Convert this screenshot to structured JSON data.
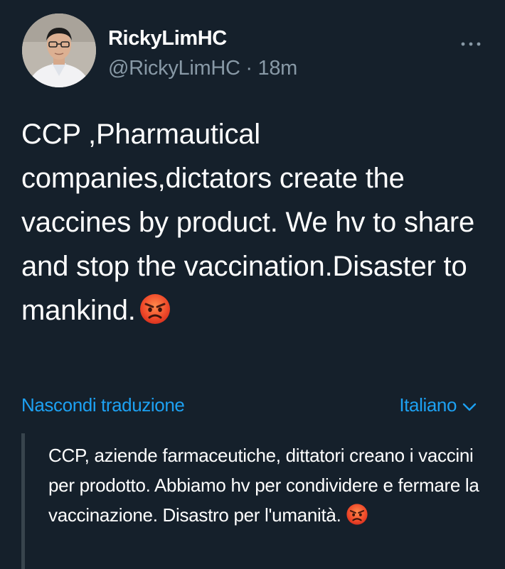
{
  "tweet": {
    "display_name": "RickyLimHC",
    "handle": "@RickyLimHC",
    "separator": " · ",
    "time": "18m",
    "text": "CCP ,Pharmautical companies,dictators create the vaccines by product. We hv to share and stop the vaccination.Disaster to mankind.",
    "text_emoji": "angry-face-emoji"
  },
  "translation": {
    "hide_label": "Nascondi traduzione",
    "language": "Italiano",
    "text": "CCP, aziende farmaceutiche, dittatori creano i vaccini per prodotto. Abbiamo hv per condividere e fermare la vaccinazione. Disastro per l'umanità.",
    "text_emoji": "angry-face-emoji"
  },
  "icons": {
    "more": "more-horizontal-icon",
    "chevron": "chevron-down-icon"
  },
  "colors": {
    "background": "#15202b",
    "text": "#ffffff",
    "muted": "#8899a6",
    "accent": "#1da1f2",
    "quote_bar": "#38444d"
  }
}
